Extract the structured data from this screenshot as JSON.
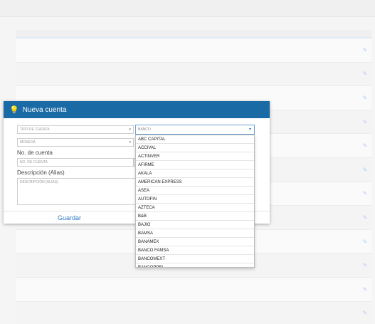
{
  "modal": {
    "title": "Nueva cuenta",
    "tipo_placeholder": "TIPO DE CUENTA",
    "moneda_placeholder": "MONEDA",
    "banco_placeholder": "BANCO",
    "no_cuenta_label": "No. de cuenta",
    "no_cuenta_placeholder": "NO. DE CUENTA",
    "descripcion_label": "Descripción (Alias)",
    "descripcion_placeholder": "DESCRIPCIÓN (ALIAS)",
    "save_label": "Guardar"
  },
  "bank_options": [
    "ABC CAPITAL",
    "ACCIVAL",
    "ACTINVER",
    "AFIRME",
    "AKALA",
    "AMERICAN EXPRESS",
    "ASEA",
    "AUTOFIN",
    "AZTECA",
    "B&B",
    "BAJIO",
    "BAMSA",
    "BANAMEX",
    "BANCO FAMSA",
    "BANCOMEXT",
    "BANCOPPEL"
  ],
  "icons": {
    "bulb": "lightbulb-icon",
    "caret": "caret-down-icon",
    "edit": "pencil-icon"
  },
  "colors": {
    "header": "#1a6aa6",
    "accent": "#2f7bc4"
  }
}
